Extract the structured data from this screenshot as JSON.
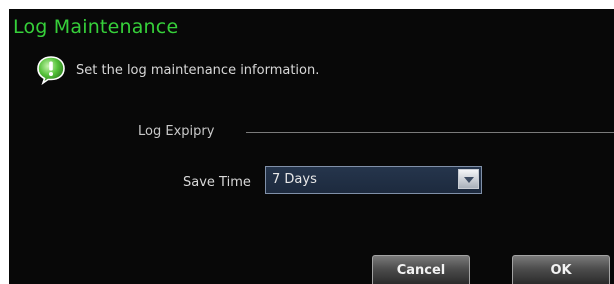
{
  "dialog": {
    "title": "Log Maintenance",
    "info_text": "Set the log maintenance information."
  },
  "log_expiry": {
    "section_label": "Log Expipry",
    "save_time_label": "Save Time",
    "save_time_value": "7 Days"
  },
  "buttons": {
    "cancel_label": "Cancel",
    "ok_label": "OK"
  },
  "colors": {
    "title": "#36d03a",
    "background": "#080808",
    "select_bg": "#25354c"
  },
  "icons": {
    "info": "info-bubble-icon",
    "dropdown": "chevron-down-icon"
  }
}
